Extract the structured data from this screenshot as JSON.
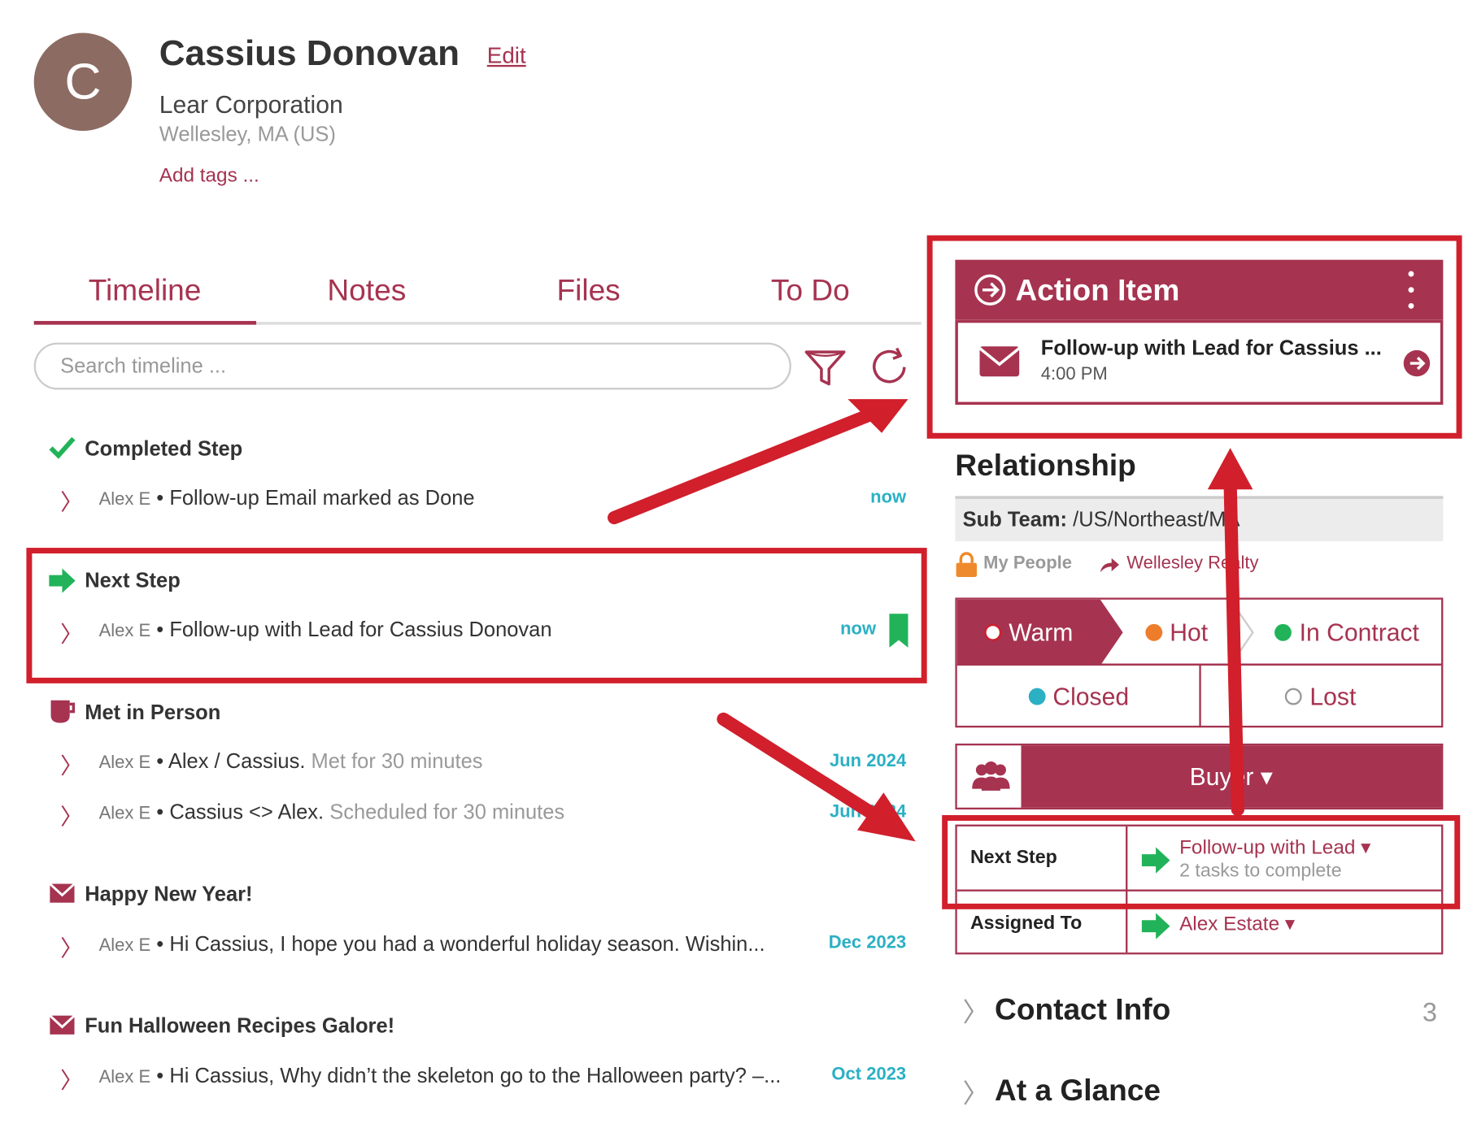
{
  "contact": {
    "initial": "C",
    "name": "Cassius Donovan",
    "edit_label": "Edit",
    "company": "Lear Corporation",
    "location": "Wellesley, MA (US)",
    "add_tags_label": "Add tags ..."
  },
  "tabs": [
    {
      "label": "Timeline",
      "active": true
    },
    {
      "label": "Notes",
      "active": false
    },
    {
      "label": "Files",
      "active": false
    },
    {
      "label": "To Do",
      "active": false
    }
  ],
  "search": {
    "placeholder": "Search timeline ..."
  },
  "timeline": [
    {
      "title": "Completed Step",
      "icon": "check-icon",
      "rows": [
        {
          "who": "Alex E",
          "text": "Follow-up Email marked as Done",
          "muted": "",
          "date": "now"
        }
      ]
    },
    {
      "title": "Next Step",
      "icon": "arrow-right-icon",
      "rows": [
        {
          "who": "Alex E",
          "text": "Follow-up with Lead for Cassius Donovan",
          "muted": "",
          "date": "now"
        }
      ]
    },
    {
      "title": "Met in Person",
      "icon": "mug-icon",
      "rows": [
        {
          "who": "Alex E",
          "text": "Alex / Cassius.",
          "muted": "Met for 30 minutes",
          "date": "Jun 2024"
        },
        {
          "who": "Alex E",
          "text": "Cassius <> Alex.",
          "muted": "Scheduled for 30 minutes",
          "date": "Jun 2024"
        }
      ]
    },
    {
      "title": "Happy New Year!",
      "icon": "envelope-icon",
      "rows": [
        {
          "who": "Alex E",
          "text": "Hi Cassius, I hope you had a wonderful holiday season.  Wishin...",
          "muted": "",
          "date": "Dec 2023"
        }
      ]
    },
    {
      "title": "Fun Halloween Recipes Galore!",
      "icon": "envelope-icon",
      "rows": [
        {
          "who": "Alex E",
          "text": "Hi Cassius, Why didn’t the skeleton go to the Halloween party? –...",
          "muted": "",
          "date": "Oct 2023"
        }
      ]
    }
  ],
  "action_item": {
    "header": "Action Item",
    "title": "Follow-up with Lead for Cassius ...",
    "time": "4:00 PM"
  },
  "relationship": {
    "title": "Relationship",
    "sub_team_label": "Sub Team:",
    "sub_team_value": "/US/Northeast/MA",
    "my_people": "My People",
    "realty": "Wellesley Realty"
  },
  "pipeline": {
    "stages": [
      {
        "label": "Warm",
        "color": "#ffffff",
        "active": true
      },
      {
        "label": "Hot",
        "color": "#ee7d2b",
        "active": false
      },
      {
        "label": "In Contract",
        "color": "#22b35a",
        "active": false
      },
      {
        "label": "Closed",
        "color": "#2bb0c4",
        "active": false
      },
      {
        "label": "Lost",
        "color": "#ffffff",
        "active": false
      }
    ]
  },
  "buyer": {
    "label": "Buyer ▾"
  },
  "next_step": {
    "label": "Next Step",
    "value": "Follow-up with Lead",
    "sub": "2 tasks to complete",
    "assigned_label": "Assigned To",
    "assigned_value": "Alex Estate"
  },
  "sections": [
    {
      "title": "Contact Info",
      "count": "3"
    },
    {
      "title": "At a Glance",
      "count": ""
    }
  ],
  "colors": {
    "brand": "#a63350",
    "accent_green": "#22b35a",
    "date_teal": "#2bb0c4",
    "highlight_red": "#d11f2c"
  }
}
